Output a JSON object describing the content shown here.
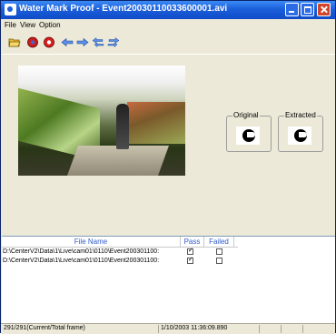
{
  "window": {
    "title": "Water Mark Proof - Event20030110033600001.avi"
  },
  "menu": {
    "items": [
      "File",
      "View",
      "Option"
    ]
  },
  "toolbar": {
    "icons": [
      "open-folder-icon",
      "disc-icon",
      "stop-icon",
      "arrow-left-icon",
      "arrow-right-icon",
      "arrow-back-double-icon",
      "arrow-forward-double-icon"
    ]
  },
  "watermark": {
    "original_label": "Original",
    "extracted_label": "Extracted"
  },
  "list": {
    "columns": [
      "File Name",
      "Pass",
      "Failed"
    ],
    "rows": [
      {
        "file": "D:\\CenterV2\\Data\\1\\Live\\cam01\\0110\\Event200301100:",
        "pass": true,
        "failed": false
      },
      {
        "file": "D:\\CenterV2\\Data\\1\\Live\\cam01\\0110\\Event200301100:",
        "pass": true,
        "failed": false
      }
    ]
  },
  "status": {
    "frame": "291/291(Current/Total frame)",
    "time": "1/10/2003 11:36:09.890"
  }
}
